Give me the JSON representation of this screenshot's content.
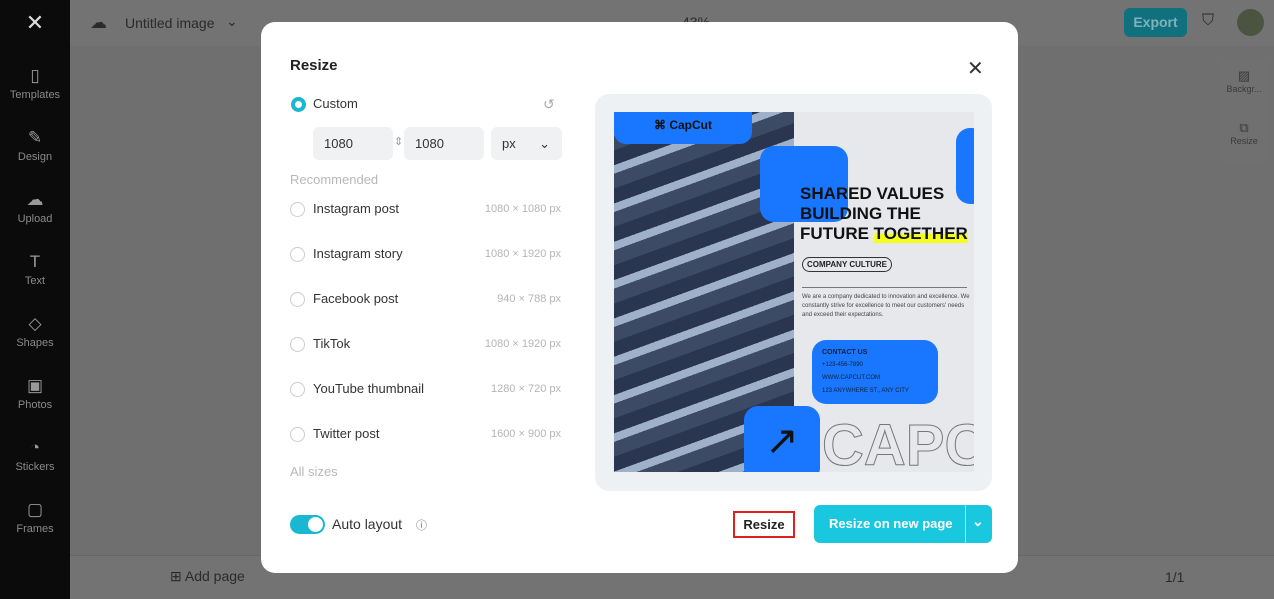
{
  "app": {
    "project_title": "Untitled image",
    "zoom": "43%",
    "export_label": "Export",
    "accent": "#19c7de"
  },
  "sidebar": {
    "items": [
      {
        "label": "Templates",
        "icon": "templates-icon"
      },
      {
        "label": "Design",
        "icon": "design-icon"
      },
      {
        "label": "Upload",
        "icon": "upload-icon"
      },
      {
        "label": "Text",
        "icon": "text-icon"
      },
      {
        "label": "Shapes",
        "icon": "shapes-icon"
      },
      {
        "label": "Photos",
        "icon": "photos-icon"
      },
      {
        "label": "Stickers",
        "icon": "stickers-icon"
      },
      {
        "label": "Frames",
        "icon": "frames-icon"
      }
    ]
  },
  "right_panel": {
    "background": "Backgr...",
    "resize": "Resize"
  },
  "bottom": {
    "add_page": "Add page",
    "page_count": "1/1"
  },
  "modal": {
    "title": "Resize",
    "custom_label": "Custom",
    "width": "1080",
    "height": "1080",
    "unit": "px",
    "recommended_label": "Recommended",
    "presets": [
      {
        "label": "Instagram post",
        "size": "1080 × 1080 px"
      },
      {
        "label": "Instagram story",
        "size": "1080 × 1920 px"
      },
      {
        "label": "Facebook post",
        "size": "940 × 788 px"
      },
      {
        "label": "TikTok",
        "size": "1080 × 1920 px"
      },
      {
        "label": "YouTube thumbnail",
        "size": "1280 × 720 px"
      },
      {
        "label": "Twitter post",
        "size": "1600 × 900 px"
      }
    ],
    "all_sizes": "All sizes",
    "auto_layout": "Auto layout",
    "resize_label": "Resize",
    "resize_new_page_label": "Resize on new page"
  },
  "preview": {
    "brand": "CapCut",
    "headline1": "SHARED VALUES",
    "headline2": "BUILDING THE",
    "headline3a": "FUTURE ",
    "headline3b": "TOGETHER",
    "tag": "COMPANY CULTURE",
    "body": "We are a company dedicated to innovation and excellence. We constantly strive for excellence to meet our customers' needs and exceed their expectations.",
    "contact_title": "CONTACT US",
    "phone": "+123-456-7890",
    "web": "WWW.CAPCUT.COM",
    "address": "123 ANYWHERE ST., ANY CITY",
    "outline_text": "CAPC"
  }
}
